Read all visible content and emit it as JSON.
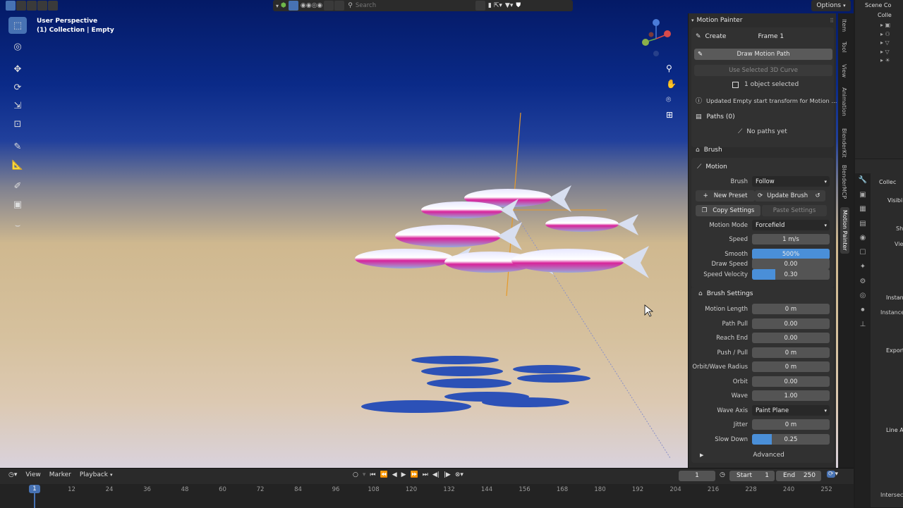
{
  "viewport": {
    "view_name": "User Perspective",
    "collection_info": "(1) Collection | Empty"
  },
  "header": {
    "search_placeholder": "Search",
    "options_label": "Options"
  },
  "panel": {
    "title": "Motion Painter",
    "create_label": "Create",
    "frame_label": "Frame 1",
    "draw_button": "Draw Motion Path",
    "use_curve_button": "Use Selected 3D Curve",
    "selection_status": "1 object selected",
    "info_message": "Updated Empty start transform for Motion ...",
    "paths_header": "Paths (0)",
    "no_paths": "No paths yet",
    "brush_header": "Brush",
    "motion_header": "Motion",
    "brush_label": "Brush",
    "brush_value": "Follow",
    "new_preset": "New Preset",
    "update_brush": "Update Brush",
    "copy_settings": "Copy Settings",
    "paste_settings": "Paste Settings",
    "motion_mode_label": "Motion Mode",
    "motion_mode_value": "Forcefield",
    "speed_label": "Speed",
    "speed_value": "1 m/s",
    "smooth_label": "Smooth",
    "smooth_value": "500%",
    "smooth_fill": 1.0,
    "draw_speed_label": "Draw Speed",
    "draw_speed_value": "0.00",
    "speed_velocity_label": "Speed Velocity",
    "speed_velocity_value": "0.30",
    "speed_velocity_fill": 0.3,
    "brush_settings_header": "Brush Settings",
    "motion_length_label": "Motion Length",
    "motion_length_value": "0 m",
    "path_pull_label": "Path Pull",
    "path_pull_value": "0.00",
    "reach_end_label": "Reach End",
    "reach_end_value": "0.00",
    "push_pull_label": "Push / Pull",
    "push_pull_value": "0 m",
    "orbit_radius_label": "Orbit/Wave Radius",
    "orbit_radius_value": "0 m",
    "orbit_label": "Orbit",
    "orbit_value": "0.00",
    "wave_label": "Wave",
    "wave_value": "1.00",
    "wave_axis_label": "Wave Axis",
    "wave_axis_value": "Paint Plane",
    "jitter_label": "Jitter",
    "jitter_value": "0 m",
    "slow_down_label": "Slow Down",
    "slow_down_value": "0.25",
    "slow_down_fill": 0.25,
    "advanced_label": "Advanced"
  },
  "tabs": [
    "Item",
    "Tool",
    "View",
    "Animation",
    "BlenderKit",
    "BlenderMCP",
    "Motion Painter"
  ],
  "active_tab": "Motion Painter",
  "outliner": {
    "title": "Scene Co",
    "collection": "Colle"
  },
  "properties": {
    "collection": "Collec",
    "visibility": "Visibi",
    "sh": "Sh",
    "view": "View",
    "instancing": "Instan",
    "instance": "Instance",
    "export": "Export",
    "line_art": "Line A",
    "intersect": "Intersec"
  },
  "timeline": {
    "view": "View",
    "marker": "Marker",
    "playback": "Playback",
    "current_frame": "1",
    "start_label": "Start",
    "start_value": "1",
    "end_label": "End",
    "end_value": "250",
    "ticks": [
      "1",
      "12",
      "24",
      "36",
      "48",
      "60",
      "72",
      "84",
      "96",
      "108",
      "120",
      "132",
      "144",
      "156",
      "168",
      "180",
      "192",
      "204",
      "216",
      "228",
      "240",
      "252"
    ]
  },
  "colors": {
    "accent": "#4772b3",
    "fill": "#4a8fd8"
  }
}
